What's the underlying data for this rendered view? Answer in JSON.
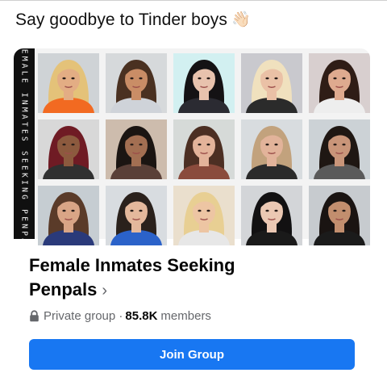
{
  "post": {
    "text": "Say goodbye to Tinder boys",
    "emoji": "👋🏻"
  },
  "group_card": {
    "cover_strip_text": "FEMALE INMATES SEEKING PENPA",
    "cover_photos": [
      {
        "icon": "portrait-photo",
        "tone": "#e3ad84",
        "hair": "#e4c279",
        "shirt": "#f26a21",
        "bg": "#cfd3d6"
      },
      {
        "icon": "portrait-photo",
        "tone": "#c98d66",
        "hair": "#4a3121",
        "shirt": "#cfd3d9",
        "bg": "#d6d9db"
      },
      {
        "icon": "portrait-photo",
        "tone": "#e8c2ad",
        "hair": "#141214",
        "shirt": "#2b2b32",
        "bg": "#d2f0f1"
      },
      {
        "icon": "portrait-photo",
        "tone": "#eac1a6",
        "hair": "#f0e1be",
        "shirt": "#2b2b2b",
        "bg": "#c9c9ce"
      },
      {
        "icon": "portrait-photo",
        "tone": "#deaa8f",
        "hair": "#2f1d16",
        "shirt": "#eeeeee",
        "bg": "#d8cfcf"
      },
      {
        "icon": "portrait-photo",
        "tone": "#8c5a3e",
        "hair": "#6f1b24",
        "shirt": "#303030",
        "bg": "#d8d8d8"
      },
      {
        "icon": "portrait-photo",
        "tone": "#a36f52",
        "hair": "#1b1512",
        "shirt": "#5a4038",
        "bg": "#cdbcad"
      },
      {
        "icon": "portrait-photo",
        "tone": "#e3b39a",
        "hair": "#4c2f23",
        "shirt": "#8a4b3c",
        "bg": "#d6dad8"
      },
      {
        "icon": "portrait-photo",
        "tone": "#e2b39a",
        "hair": "#c2a27d",
        "shirt": "#2b2b2b",
        "bg": "#d8dcdf"
      },
      {
        "icon": "portrait-photo",
        "tone": "#c99579",
        "hair": "#1f1713",
        "shirt": "#5a5a5a",
        "bg": "#ccd2d6"
      },
      {
        "icon": "portrait-photo",
        "tone": "#d9a586",
        "hair": "#5a3b29",
        "shirt": "#2a3a7a",
        "bg": "#c6cdd2"
      },
      {
        "icon": "portrait-photo",
        "tone": "#e4b89c",
        "hair": "#2a211c",
        "shirt": "#2b62c9",
        "bg": "#d8dce0"
      },
      {
        "icon": "portrait-photo",
        "tone": "#edc5a3",
        "hair": "#e8cf93",
        "shirt": "#e7e7e7",
        "bg": "#eadfcd"
      },
      {
        "icon": "portrait-photo",
        "tone": "#ebc8b3",
        "hair": "#121112",
        "shirt": "#1a1a1a",
        "bg": "#d3d5d8"
      },
      {
        "icon": "portrait-photo",
        "tone": "#c28e6e",
        "hair": "#1a1412",
        "shirt": "#1b1b1b",
        "bg": "#c7cbcf"
      }
    ],
    "title": "Female Inmates Seeking Penpals",
    "title_chevron": "›",
    "privacy_icon": "lock-icon",
    "privacy": "Private group ·",
    "member_count": "85.8K",
    "members_label": "members",
    "join_label": "Join Group",
    "accent": "#1877f2"
  }
}
